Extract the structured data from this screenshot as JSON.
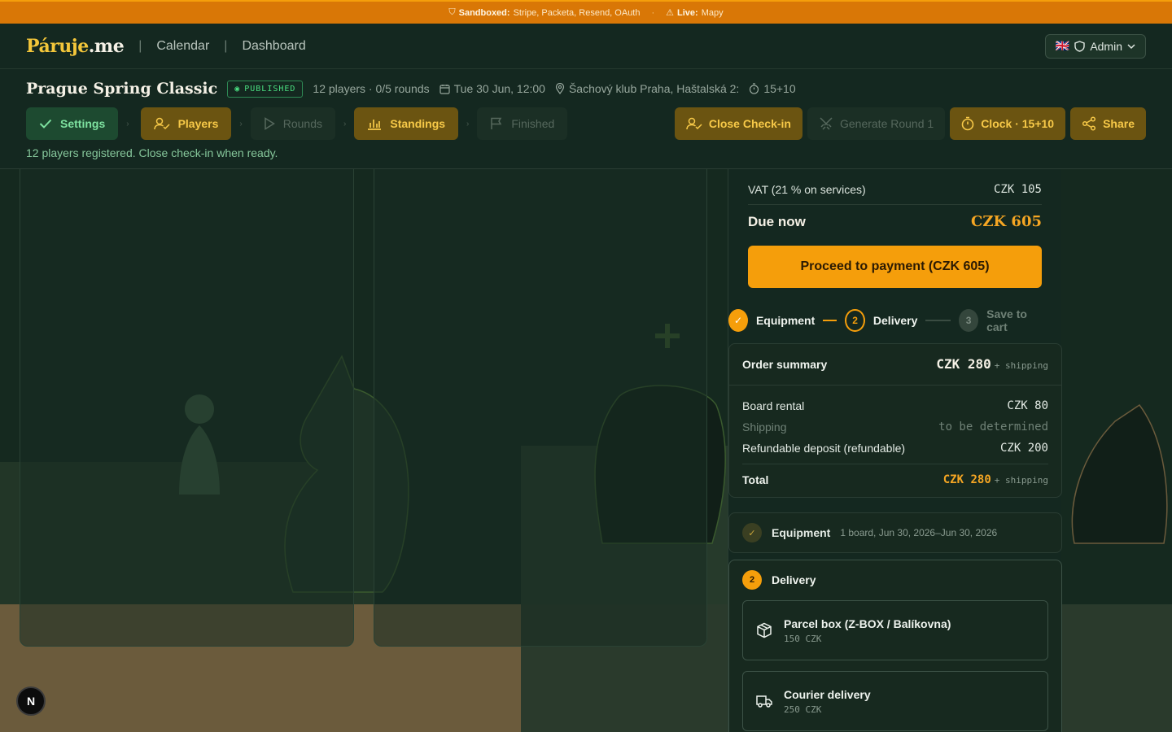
{
  "banner": {
    "sandboxed_label": "Sandboxed:",
    "sandboxed_value": "Stripe, Packeta, Resend, OAuth",
    "live_label": "Live:",
    "live_value": "Mapy"
  },
  "nav": {
    "logo_main": "Páruje",
    "logo_suffix": ".me",
    "links": [
      "Calendar",
      "Dashboard"
    ],
    "admin_flag": "🇬🇧",
    "admin_label": "Admin"
  },
  "tournament": {
    "title": "Prague Spring Classic",
    "status": "PUBLISHED",
    "players_rounds": "12 players · 0/5 rounds",
    "datetime": "Tue 30 Jun, 12:00",
    "venue": "Šachový klub Praha, Haštalská 2:",
    "time_control": "15+10",
    "steps": [
      "Settings",
      "Players",
      "Rounds",
      "Standings",
      "Finished"
    ],
    "actions": [
      "Close Check-in",
      "Generate Round 1",
      "Clock · 15+10",
      "Share"
    ],
    "hint": "12 players registered. Close check-in when ready."
  },
  "checkout": {
    "vat_label": "VAT (21 % on services)",
    "vat_value": "CZK 105",
    "due_label": "Due now",
    "due_value": "CZK 605",
    "pay_button": "Proceed to payment (CZK 605)",
    "wizard": {
      "step1": "Equipment",
      "step2_num": "2",
      "step2": "Delivery",
      "step3_num": "3",
      "step3": "Save to cart"
    },
    "summary": {
      "title": "Order summary",
      "amount": "CZK 280",
      "shipping_suffix": "+ shipping",
      "lines": [
        {
          "label": "Board rental",
          "value": "CZK 80"
        },
        {
          "label": "Shipping",
          "value": "to be determined"
        },
        {
          "label": "Refundable deposit (refundable)",
          "value": "CZK 200"
        }
      ],
      "total_label": "Total",
      "total_value": "CZK 280",
      "total_suffix": "+ shipping"
    },
    "equipment": {
      "label": "Equipment",
      "detail": "1 board, Jun 30, 2026–Jun 30, 2026"
    },
    "delivery": {
      "num": "2",
      "label": "Delivery",
      "options": [
        {
          "title": "Parcel box (Z-BOX / Balíkovna)",
          "price": "150 CZK"
        },
        {
          "title": "Courier delivery",
          "price": "250 CZK"
        }
      ]
    }
  },
  "fab_label": "N",
  "colors": {
    "accent": "#f59e0b",
    "banner": "#d97706",
    "background": "#142820",
    "success": "#4ade80"
  }
}
